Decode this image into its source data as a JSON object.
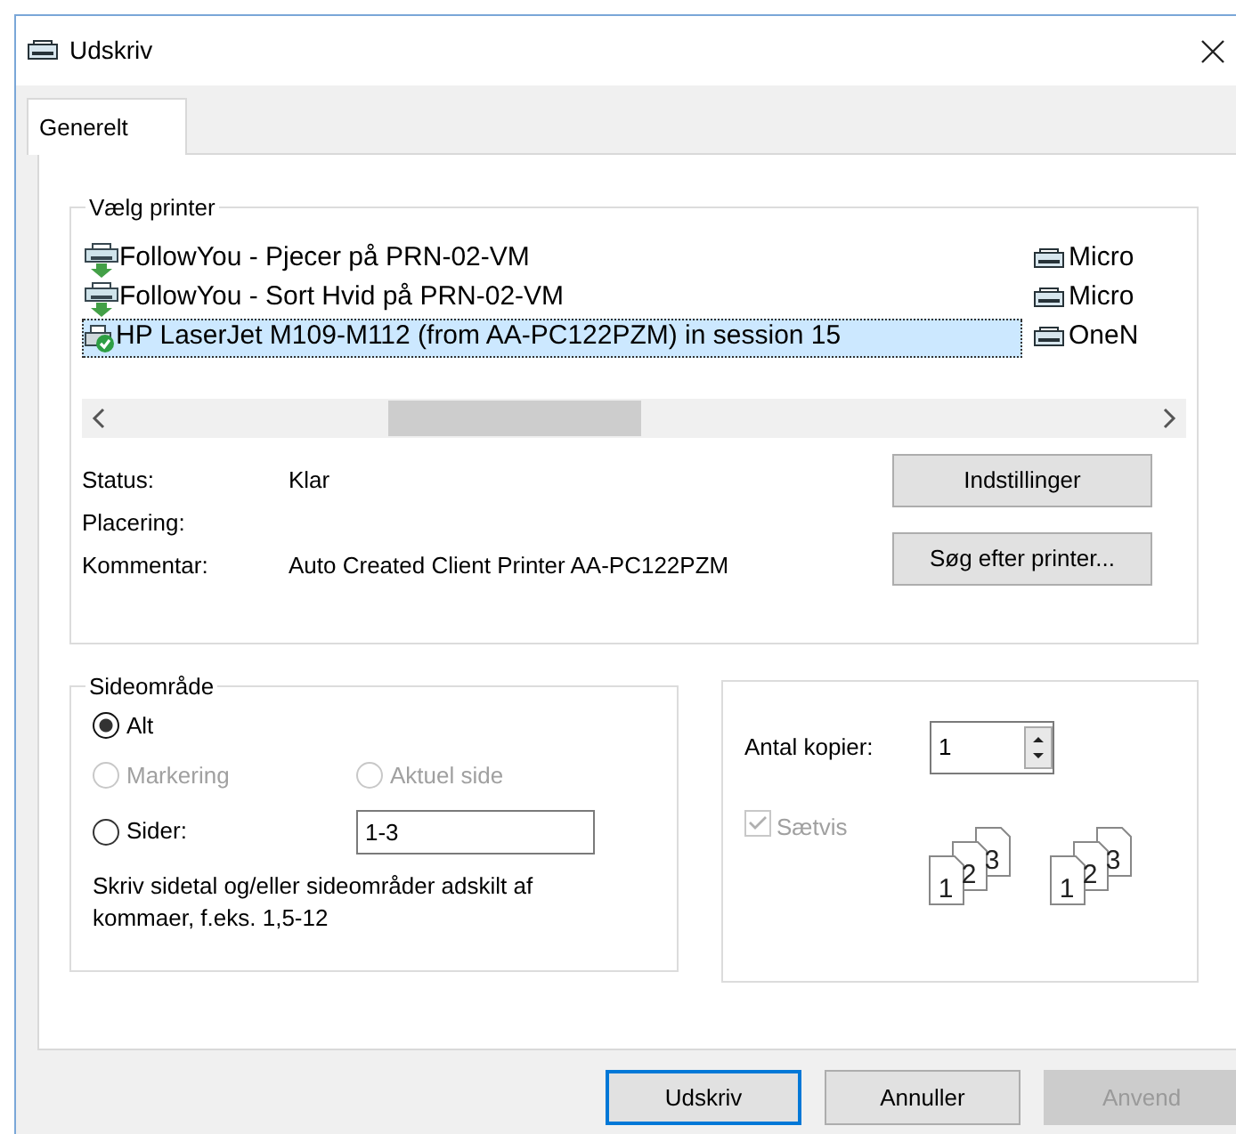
{
  "window": {
    "title": "Udskriv"
  },
  "tabs": [
    {
      "label": "Generelt",
      "selected": true
    }
  ],
  "printer_group": {
    "title": "Vælg printer",
    "printers": [
      {
        "name": "FollowYou - Pjecer på PRN-02-VM",
        "column_2": "Micro",
        "kind": "network",
        "selected": false
      },
      {
        "name": "FollowYou - Sort Hvid på PRN-02-VM",
        "column_2": "Micro",
        "kind": "network",
        "selected": false
      },
      {
        "name": "HP LaserJet M109-M112 (from AA-PC122PZM) in session 15",
        "column_2": "OneN",
        "kind": "default",
        "selected": true
      }
    ],
    "details": [
      {
        "label": "Status:",
        "value": "Klar"
      },
      {
        "label": "Placering:"
      },
      {
        "label": "Kommentar:",
        "value": "Auto Created Client Printer AA-PC122PZM"
      }
    ],
    "buttons": [
      "Indstillinger",
      "Søg efter printer..."
    ]
  },
  "page_range": {
    "title": "Sideområde",
    "options": [
      {
        "label": "Alt",
        "selected": true,
        "disabled": false
      },
      {
        "label": "Markering",
        "selected": false,
        "disabled": true
      },
      {
        "label": "Aktuel side",
        "selected": false,
        "disabled": true
      },
      {
        "label": "Sider:",
        "selected": false,
        "disabled": false
      }
    ],
    "pages_value": "1-3",
    "hint": "Skriv sidetal og/eller sideområder adskilt af kommaer, f.eks. 1,5-12"
  },
  "copies": {
    "label": "Antal kopier:",
    "value": "1",
    "collate": {
      "label": "Sætvis",
      "checked": true,
      "disabled": true
    },
    "collate_icons": [
      [
        "1",
        "2",
        "3"
      ],
      [
        "1",
        "2",
        "3"
      ]
    ]
  },
  "buttons": [
    {
      "label": "Udskriv",
      "kind": "default"
    },
    {
      "label": "Annuller",
      "kind": "normal"
    },
    {
      "label": "Anvend",
      "kind": "disabled"
    }
  ]
}
